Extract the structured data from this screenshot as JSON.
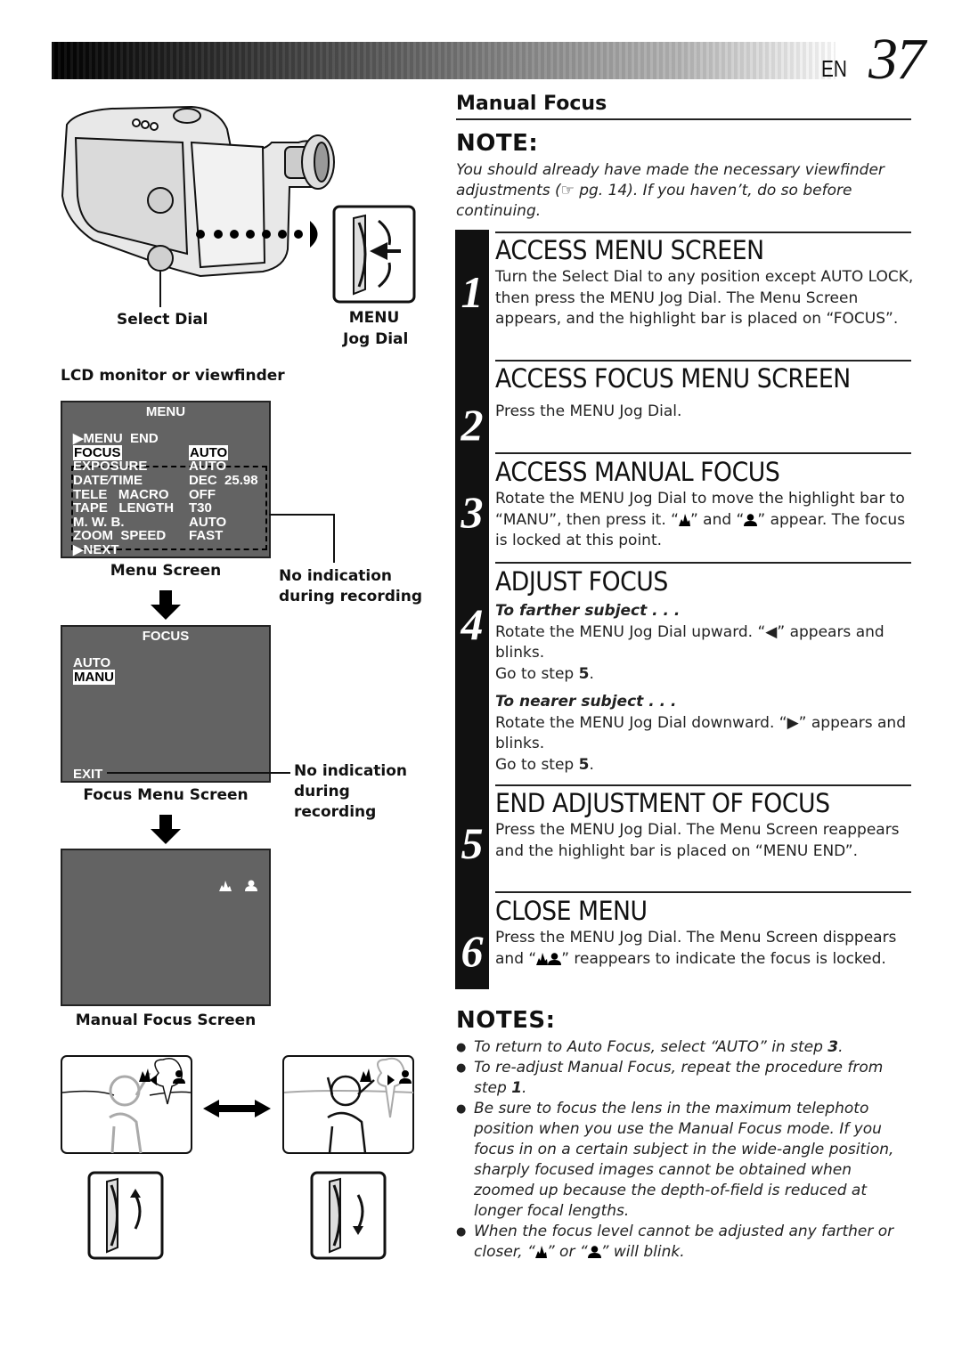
{
  "header": {
    "lang": "EN",
    "page_number": "37"
  },
  "left": {
    "camera_labels": {
      "select_dial": "Select Dial",
      "menu_jog_line1": "MENU",
      "menu_jog_line2": "Jog Dial"
    },
    "lcd_label": "LCD monitor or viewfinder",
    "menu_screen": {
      "title": "MENU",
      "rows": [
        {
          "label": "▶MENU  END",
          "value": ""
        },
        {
          "label": "FOCUS",
          "value": "AUTO",
          "highlighted": true
        },
        {
          "label": "EXPOSURE",
          "value": "AUTO"
        },
        {
          "label": "DATE⁄TIME",
          "value": "DEC  25.98"
        },
        {
          "label": "TELE   MACRO",
          "value": "OFF"
        },
        {
          "label": "TAPE   LENGTH",
          "value": "T30"
        },
        {
          "label": "M. W. B.",
          "value": "AUTO"
        },
        {
          "label": "ZOOM  SPEED",
          "value": "FAST"
        },
        {
          "label": "▶NEXT",
          "value": ""
        }
      ],
      "caption": "Menu Screen",
      "callout_line1": "No indication",
      "callout_line2": "during recording"
    },
    "focus_menu_screen": {
      "title": "FOCUS",
      "options": [
        "AUTO",
        "MANU"
      ],
      "selected": "MANU",
      "exit": "EXIT",
      "caption": "Focus Menu Screen",
      "callout_line1": "No indication",
      "callout_line2": "during",
      "callout_line3": "recording"
    },
    "manual_focus_screen": {
      "caption": "Manual Focus Screen",
      "icons": [
        "far-focus-icon",
        "near-focus-icon"
      ]
    }
  },
  "right": {
    "section_title": "Manual Focus",
    "note": {
      "heading": "NOTE:",
      "text": "You should already have made the necessary viewfinder adjustments (☞ pg. 14). If you haven’t, do so before continuing."
    },
    "steps": [
      {
        "num": "1",
        "title": "ACCESS MENU SCREEN",
        "body": "Turn the Select Dial to any position except AUTO LOCK, then press the MENU Jog Dial. The Menu Screen appears, and the highlight bar is placed on “FOCUS”."
      },
      {
        "num": "2",
        "title": "ACCESS FOCUS MENU SCREEN",
        "body": "Press the MENU Jog Dial."
      },
      {
        "num": "3",
        "title": "ACCESS MANUAL FOCUS",
        "body_a": "Rotate the MENU Jog Dial to move the highlight bar to “MANU”, then press it. “",
        "body_b": "” and “",
        "body_c": "” appear. The focus is locked at this point."
      },
      {
        "num": "4",
        "title": "ADJUST FOCUS",
        "far_heading": "To farther subject . . .",
        "far_body": "Rotate the MENU Jog Dial upward. “◀” appears and blinks.",
        "far_goto": "Go to step ",
        "far_goto_step": "5",
        "near_heading": "To nearer subject . . .",
        "near_body": "Rotate the MENU Jog Dial downward. “▶” appears and blinks.",
        "near_goto": "Go to step ",
        "near_goto_step": "5"
      },
      {
        "num": "5",
        "title": "END ADJUSTMENT OF FOCUS",
        "body": "Press the MENU Jog Dial. The Menu Screen reappears and the highlight bar is placed on “MENU END”."
      },
      {
        "num": "6",
        "title": "CLOSE MENU",
        "body_a": "Press the MENU Jog Dial. The Menu Screen disppears and “",
        "body_b": "” reappears to indicate the focus is locked."
      }
    ],
    "notes": {
      "heading": "NOTES:",
      "items": [
        {
          "text": "To return to Auto Focus, select “AUTO” in step ",
          "bold": "3",
          "tail": "."
        },
        {
          "text": "To re-adjust Manual Focus, repeat the procedure from step ",
          "bold": "1",
          "tail": "."
        },
        {
          "text": "Be sure to focus the lens in the maximum telephoto position when you use the Manual Focus mode. If you focus in on a certain subject in the wide-angle position, sharply focused images cannot be obtained when zoomed up because the depth-of-field is reduced at longer focal lengths.",
          "bold": "",
          "tail": ""
        },
        {
          "text_a": "When the focus level cannot be adjusted any farther or closer, “",
          "text_b": "” or “",
          "text_c": "” will blink."
        }
      ]
    }
  }
}
